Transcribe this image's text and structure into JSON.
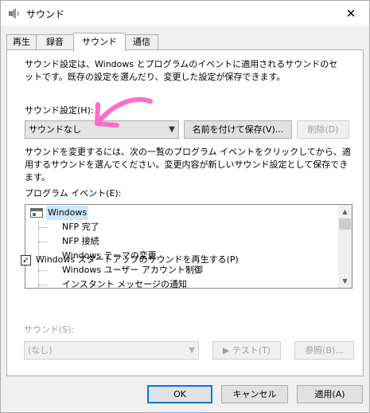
{
  "window": {
    "title": "サウンド",
    "close_glyph": "✕"
  },
  "tabs": [
    {
      "label": "再生"
    },
    {
      "label": "録音"
    },
    {
      "label": "サウンド"
    },
    {
      "label": "通信"
    }
  ],
  "sound_tab": {
    "description": "サウンド設定は、Windows とプログラムのイベントに適用されるサウンドのセットです。既存の設定を選んだり、変更した設定が保存できます。",
    "scheme_label": "サウンド設定(H):",
    "scheme_value": "サウンドなし",
    "save_as_label": "名前を付けて保存(V)...",
    "delete_label": "削除(D)",
    "instructions": "サウンドを変更するには、次の一覧のプログラム イベントをクリックしてから、適用するサウンドを選んでください。変更内容が新しいサウンド設定として保存できます。",
    "events_label": "プログラム イベント(E):",
    "events": {
      "root": "Windows",
      "items": [
        "NFP 完了",
        "NFP 接続",
        "Windows テーマの変更",
        "Windows ユーザー アカウント制御",
        "インスタント メッセージの通知"
      ]
    },
    "startup_checkbox_label": "Windows スタートアップのサウンドを再生する(P)",
    "startup_checked": true,
    "check_glyph": "✓",
    "sounds_label": "サウンド(S):",
    "sounds_value": "(なし)",
    "test_label": "▶ テスト(T)",
    "browse_label": "参照(B)..."
  },
  "footer": {
    "ok_label": "OK",
    "cancel_label": "キャンセル",
    "apply_label": "適用(A)"
  },
  "colors": {
    "annotation_arrow": "#ff6ec7",
    "selection": "#cce8ff",
    "primary_border": "#0078d7"
  }
}
